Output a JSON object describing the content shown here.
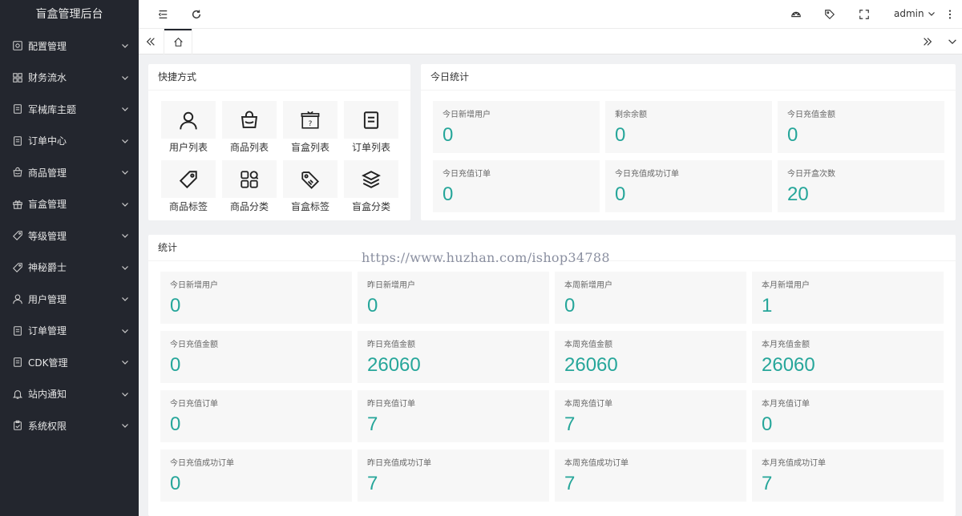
{
  "app": {
    "title": "盲盒管理后台"
  },
  "sidebar": {
    "items": [
      {
        "label": "配置管理",
        "icon": "config-icon"
      },
      {
        "label": "财务流水",
        "icon": "grid-icon"
      },
      {
        "label": "军械库主题",
        "icon": "document-icon"
      },
      {
        "label": "订单中心",
        "icon": "document-icon"
      },
      {
        "label": "商品管理",
        "icon": "bag-icon"
      },
      {
        "label": "盲盒管理",
        "icon": "gift-icon"
      },
      {
        "label": "等级管理",
        "icon": "tag-icon"
      },
      {
        "label": "神秘爵士",
        "icon": "tag-icon"
      },
      {
        "label": "用户管理",
        "icon": "user-icon"
      },
      {
        "label": "订单管理",
        "icon": "document-icon"
      },
      {
        "label": "CDK管理",
        "icon": "document-icon"
      },
      {
        "label": "站内通知",
        "icon": "bell-icon"
      },
      {
        "label": "系统权限",
        "icon": "clipboard-icon"
      }
    ]
  },
  "topbar": {
    "user": "admin"
  },
  "shortcuts": {
    "title": "快捷方式",
    "items": [
      {
        "label": "用户列表",
        "icon": "user-icon"
      },
      {
        "label": "商品列表",
        "icon": "bag-icon"
      },
      {
        "label": "盲盒列表",
        "icon": "mystery-box-icon"
      },
      {
        "label": "订单列表",
        "icon": "document-icon"
      },
      {
        "label": "商品标签",
        "icon": "tag-icon"
      },
      {
        "label": "商品分类",
        "icon": "category-icon"
      },
      {
        "label": "盲盒标签",
        "icon": "tags-icon"
      },
      {
        "label": "盲盒分类",
        "icon": "layers-icon"
      }
    ]
  },
  "today": {
    "title": "今日统计",
    "cards": [
      {
        "label": "今日新增用户",
        "value": "0"
      },
      {
        "label": "剩余余额",
        "value": "0"
      },
      {
        "label": "今日充值金额",
        "value": "0"
      },
      {
        "label": "今日充值订单",
        "value": "0"
      },
      {
        "label": "今日充值成功订单",
        "value": "0"
      },
      {
        "label": "今日开盒次数",
        "value": "20"
      }
    ]
  },
  "stats": {
    "title": "统计",
    "cards": [
      {
        "label": "今日新增用户",
        "value": "0"
      },
      {
        "label": "昨日新增用户",
        "value": "0"
      },
      {
        "label": "本周新增用户",
        "value": "0"
      },
      {
        "label": "本月新增用户",
        "value": "1"
      },
      {
        "label": "今日充值金额",
        "value": "0"
      },
      {
        "label": "昨日充值金额",
        "value": "26060"
      },
      {
        "label": "本周充值金额",
        "value": "26060"
      },
      {
        "label": "本月充值金额",
        "value": "26060"
      },
      {
        "label": "今日充值订单",
        "value": "0"
      },
      {
        "label": "昨日充值订单",
        "value": "7"
      },
      {
        "label": "本周充值订单",
        "value": "7"
      },
      {
        "label": "本月充值订单",
        "value": "0"
      },
      {
        "label": "今日充值成功订单",
        "value": "0"
      },
      {
        "label": "昨日充值成功订单",
        "value": "7"
      },
      {
        "label": "本周充值成功订单",
        "value": "7"
      },
      {
        "label": "本月充值成功订单",
        "value": "7"
      }
    ]
  },
  "watermark": "https://www.huzhan.com/ishop34788",
  "colors": {
    "sidebar_bg": "#23262e",
    "accent": "#26a69a",
    "card_bg": "#f7f7f7"
  }
}
